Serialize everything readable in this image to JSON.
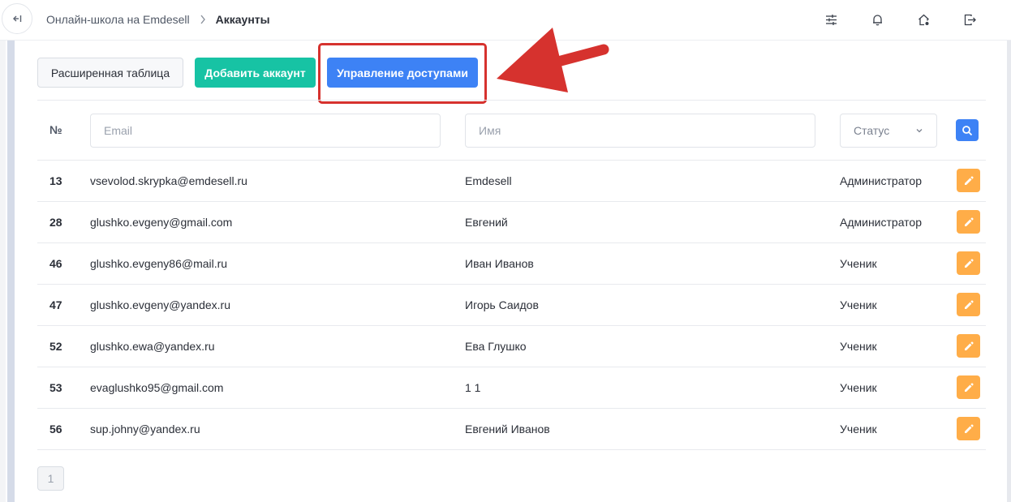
{
  "header": {
    "breadcrumb": {
      "parent": "Онлайн-школа на Emdesell",
      "current": "Аккаунты"
    },
    "icons": [
      "sliders-icon",
      "bell-icon",
      "home-settings-icon",
      "logout-icon"
    ]
  },
  "toolbar": {
    "extended_table_label": "Расширенная таблица",
    "add_account_label": "Добавить аккаунт",
    "access_management_label": "Управление доступами"
  },
  "filters": {
    "number_header": "№",
    "email_placeholder": "Email",
    "name_placeholder": "Имя",
    "status_placeholder": "Статус"
  },
  "accounts": [
    {
      "id": "13",
      "email": "vsevolod.skrypka@emdesell.ru",
      "name": "Emdesell",
      "status": "Администратор"
    },
    {
      "id": "28",
      "email": "glushko.evgeny@gmail.com",
      "name": "Евгений",
      "status": "Администратор"
    },
    {
      "id": "46",
      "email": "glushko.evgeny86@mail.ru",
      "name": "Иван Иванов",
      "status": "Ученик"
    },
    {
      "id": "47",
      "email": "glushko.evgeny@yandex.ru",
      "name": "Игорь Саидов",
      "status": "Ученик"
    },
    {
      "id": "52",
      "email": "glushko.ewa@yandex.ru",
      "name": "Ева Глушко",
      "status": "Ученик"
    },
    {
      "id": "53",
      "email": "evaglushko95@gmail.com",
      "name": "1 1",
      "status": "Ученик"
    },
    {
      "id": "56",
      "email": "sup.johny@yandex.ru",
      "name": "Евгений Иванов",
      "status": "Ученик"
    }
  ],
  "pagination": {
    "current_page": "1"
  },
  "colors": {
    "primary": "#3d82f5",
    "success": "#17c3a4",
    "warning": "#ffad48",
    "annotation": "#d6322e"
  }
}
